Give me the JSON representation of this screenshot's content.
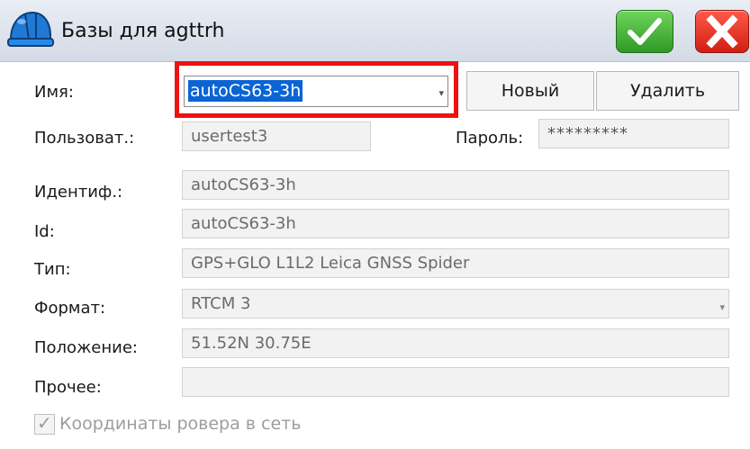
{
  "window": {
    "title": "Базы  для agttrh"
  },
  "toolbar": {
    "ok_icon": "checkmark-icon",
    "cancel_icon": "close-x-icon"
  },
  "form": {
    "name_label": "Имя:",
    "name_value": "autoCS63-3h",
    "new_button": "Новый",
    "delete_button": "Удалить",
    "user_label": "Пользоват.:",
    "user_value": "usertest3",
    "password_label": "Пароль:",
    "password_value": "*********",
    "ident_label": "Идентиф.:",
    "ident_value": "autoCS63-3h",
    "id_label": "Id:",
    "id_value": "autoCS63-3h",
    "type_label": "Тип:",
    "type_value": "GPS+GLO L1L2 Leica GNSS Spider",
    "format_label": "Формат:",
    "format_value": "RTCM 3",
    "position_label": "Положение:",
    "position_value": "51.52N 30.75E",
    "other_label": "Прочее:",
    "other_value": "",
    "rover_checkbox_label": "Координаты ровера в сеть",
    "rover_checkbox_checked": true
  },
  "colors": {
    "highlight_border": "#ee1111",
    "selection": "#0b64d4",
    "ok_green": "#2f9a26",
    "cancel_red": "#d01f12"
  }
}
